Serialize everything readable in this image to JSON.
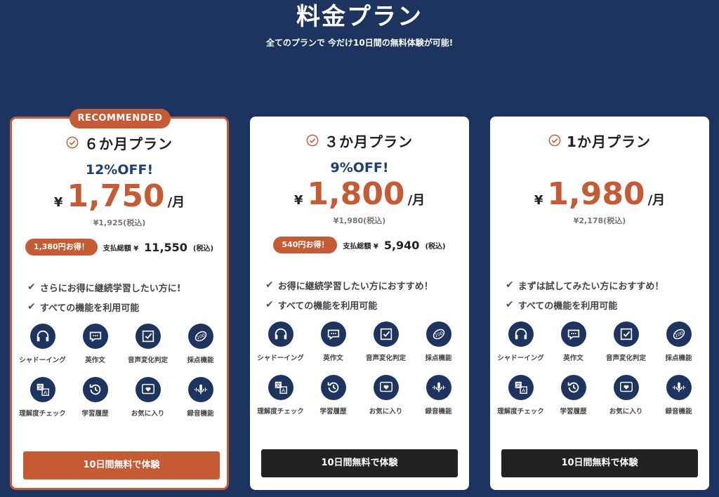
{
  "header": {
    "title": "料金プラン",
    "subtitle": "全てのプランで 今だけ10日間の無料体験が可能!"
  },
  "colors": {
    "background": "#1d3461",
    "accent": "#c65b33",
    "discount_text": "#1d3f78",
    "dark_button": "#222222"
  },
  "plans": [
    {
      "badge": "RECOMMENDED",
      "name": "６か月プラン",
      "discount": "12%OFF!",
      "yen": "¥",
      "price": "1,750",
      "per": "/月",
      "tax_price": "¥1,925(税込)",
      "saving": "1,380円お得！",
      "total_label": "支払総額 ¥",
      "total_amount": "11,550",
      "total_tax": "(税込)",
      "features": [
        "さらにお得に継続学習したい方に!",
        "すべての機能を利用可能"
      ],
      "cta": "10日間無料で体験"
    },
    {
      "name": "３か月プラン",
      "discount": "9%OFF!",
      "yen": "¥",
      "price": "1,800",
      "per": "/月",
      "tax_price": "¥1,980(税込)",
      "saving": "540円お得！",
      "total_label": "支払総額 ¥",
      "total_amount": "5,940",
      "total_tax": "(税込)",
      "features": [
        "お得に継続学習したい方におすすめ！",
        "すべての機能を利用可能"
      ],
      "cta": "10日間無料で体験"
    },
    {
      "name": "1か月プラン",
      "yen": "¥",
      "price": "1,980",
      "per": "/月",
      "tax_price": "¥2,178(税込)",
      "features": [
        "まずは試してみたい方におすすめ！",
        "すべての機能を利用可能"
      ],
      "cta": "10日間無料で体験"
    }
  ],
  "feature_icons": [
    {
      "label": "シャドーイング",
      "icon": "headphones-icon"
    },
    {
      "label": "英作文",
      "icon": "chat-bubble-icon"
    },
    {
      "label": "音声変化判定",
      "icon": "checkbox-icon"
    },
    {
      "label": "採点機能",
      "icon": "score-100-icon"
    },
    {
      "label": "理解度チェック",
      "icon": "translate-icon"
    },
    {
      "label": "学習履歴",
      "icon": "history-icon"
    },
    {
      "label": "お気に入り",
      "icon": "heart-icon"
    },
    {
      "label": "録音機能",
      "icon": "microphone-icon"
    }
  ]
}
